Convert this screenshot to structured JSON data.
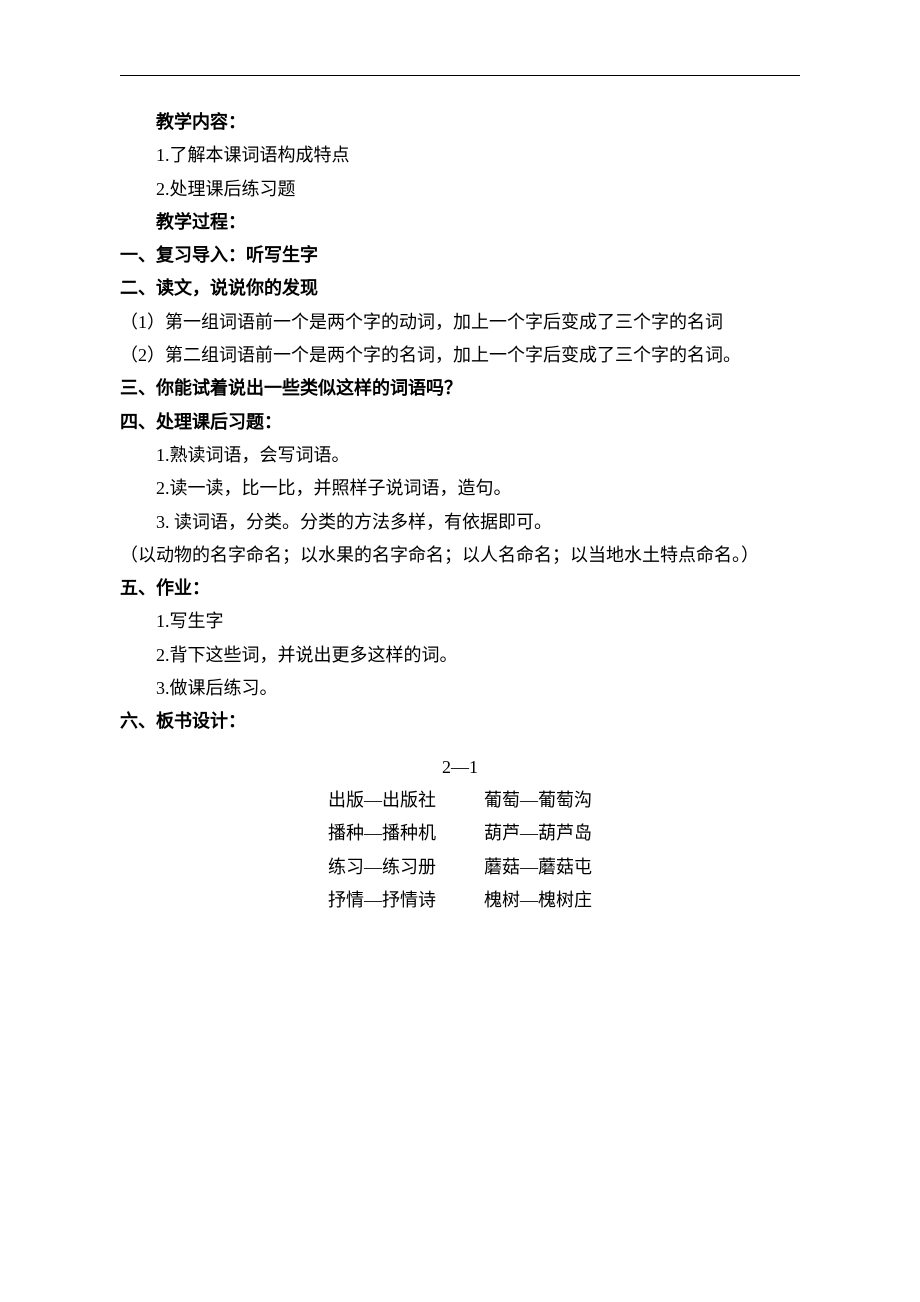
{
  "sections": {
    "contentLabel": "教学内容：",
    "contentItems": [
      "1.了解本课词语构成特点",
      "2.处理课后练习题"
    ],
    "processLabel": "教学过程：",
    "h1": "一、复习导入：听写生字",
    "h2": "二、读文，说说你的发现",
    "h2Items": [
      "（1）第一组词语前一个是两个字的动词，加上一个字后变成了三个字的名词",
      "（2）第二组词语前一个是两个字的名词，加上一个字后变成了三个字的名词。"
    ],
    "h3": "三、你能试着说出一些类似这样的词语吗？",
    "h4": "四、处理课后习题：",
    "h4Items": [
      "1.熟读词语，会写词语。",
      "2.读一读，比一比，并照样子说词语，造句。",
      "3. 读词语，分类。分类的方法多样，有依据即可。"
    ],
    "h4Note": "（以动物的名字命名；以水果的名字命名；以人名命名；以当地水土特点命名。）",
    "h5": "五、作业：",
    "h5Items": [
      "1.写生字",
      "2.背下这些词，并说出更多这样的词。",
      "3.做课后练习。"
    ],
    "h6": "六、板书设计："
  },
  "board": {
    "title": "2—1",
    "rows": [
      [
        "出版—出版社",
        "葡萄—葡萄沟"
      ],
      [
        "播种—播种机",
        "葫芦—葫芦岛"
      ],
      [
        "练习—练习册",
        "蘑菇—蘑菇屯"
      ],
      [
        "抒情—抒情诗",
        "槐树—槐树庄"
      ]
    ]
  }
}
